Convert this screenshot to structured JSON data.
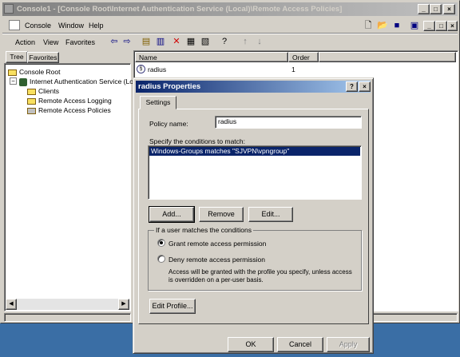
{
  "window": {
    "title": "Console1 - [Console Root\\Internet Authentication Service (Local)\\Remote Access Policies]"
  },
  "caption_buttons": {
    "minimize": "_",
    "maximize": "□",
    "close": "×"
  },
  "menubar": {
    "items": [
      "Console",
      "Window",
      "Help"
    ]
  },
  "toolbar": {
    "items": [
      "Action",
      "View",
      "Favorites"
    ]
  },
  "tabs": [
    "Tree",
    "Favorites"
  ],
  "tree": {
    "items": [
      {
        "label": "Console Root"
      },
      {
        "label": "Internet Authentication Service (Lo"
      },
      {
        "label": "Clients"
      },
      {
        "label": "Remote Access Logging"
      },
      {
        "label": "Remote Access Policies"
      }
    ]
  },
  "list": {
    "columns": [
      "Name",
      "Order"
    ],
    "rows": [
      {
        "name": "radius",
        "order": "1"
      }
    ]
  },
  "dialog": {
    "title": "radius Properties",
    "help": "?",
    "close": "×",
    "tab": "Settings",
    "policy_name_label": "Policy name:",
    "policy_name_value": "radius",
    "conditions_label": "Specify the conditions to match:",
    "conditions": [
      "Windows-Groups matches \"SJVPN\\vpngroup\""
    ],
    "add_button": "Add...",
    "remove_button": "Remove",
    "edit_button": "Edit...",
    "group_label": "If a user matches the conditions",
    "grant_label": "Grant remote access permission",
    "deny_label": "Deny remote access permission",
    "note": "Access will be granted with the profile you specify, unless access is overridden on a per-user basis.",
    "edit_profile_button": "Edit Profile...",
    "ok_button": "OK",
    "cancel_button": "Cancel",
    "apply_button": "Apply"
  }
}
